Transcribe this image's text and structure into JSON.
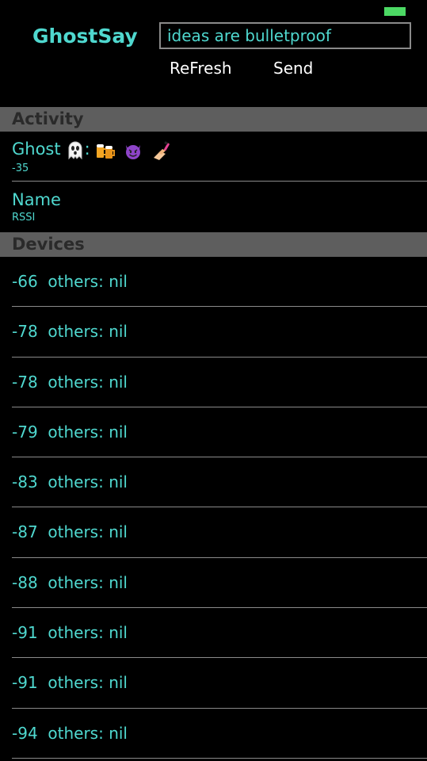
{
  "app": {
    "title": "GhostSay"
  },
  "compose": {
    "message": "ideas are bulletproof"
  },
  "actions": {
    "refresh_label": "ReFresh",
    "send_label": "Send"
  },
  "sections": {
    "activity": "Activity",
    "devices": "Devices"
  },
  "activity": [
    {
      "title": "Ghost",
      "suffix": ":",
      "subtitle": "-35",
      "icons": [
        "ghost-emoji",
        "beer-mugs-emoji",
        "smiling-devil-emoji",
        "nail-polish-emoji"
      ]
    },
    {
      "title": "Name",
      "subtitle": "RSSI"
    }
  ],
  "devices": [
    {
      "rssi": "-66",
      "text": "others: nil"
    },
    {
      "rssi": "-78",
      "text": "others: nil"
    },
    {
      "rssi": "-78",
      "text": "others: nil"
    },
    {
      "rssi": "-79",
      "text": "others: nil"
    },
    {
      "rssi": "-83",
      "text": "others: nil"
    },
    {
      "rssi": "-87",
      "text": "others: nil"
    },
    {
      "rssi": "-88",
      "text": "others: nil"
    },
    {
      "rssi": "-91",
      "text": "others: nil"
    },
    {
      "rssi": "-91",
      "text": "others: nil"
    },
    {
      "rssi": "-94",
      "text": "others: nil"
    }
  ],
  "colors": {
    "accent": "#4fd8cf",
    "background": "#000000",
    "section_header": "#5e5e5e",
    "battery": "#4cd964"
  }
}
